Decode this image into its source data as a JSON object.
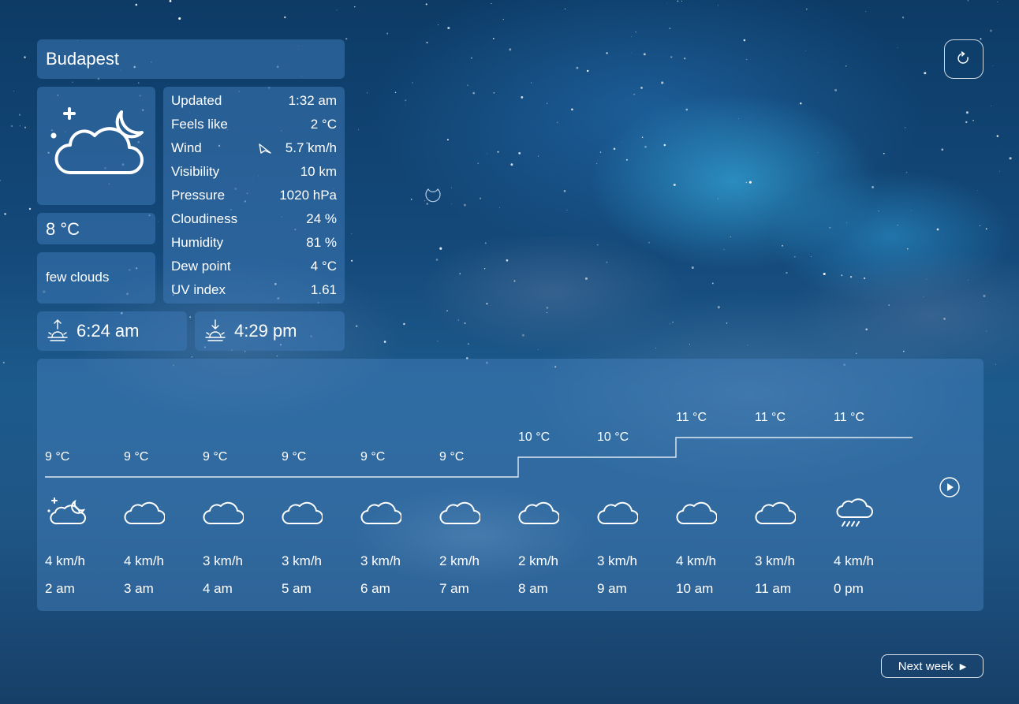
{
  "location": {
    "city": "Budapest"
  },
  "current": {
    "icon": "night-few-clouds-icon",
    "temperature": "8 °C",
    "description": "few clouds"
  },
  "details": [
    {
      "label": "Updated",
      "value": "1:32 am"
    },
    {
      "label": "Feels like",
      "value": "2 °C"
    },
    {
      "label": "Wind",
      "value": "5.7 km/h",
      "icon": "wind-direction-icon"
    },
    {
      "label": "Visibility",
      "value": "10 km"
    },
    {
      "label": "Pressure",
      "value": "1020 hPa"
    },
    {
      "label": "Cloudiness",
      "value": "24 %"
    },
    {
      "label": "Humidity",
      "value": "81 %"
    },
    {
      "label": "Dew point",
      "value": "4 °C"
    },
    {
      "label": "UV index",
      "value": "1.61"
    }
  ],
  "sun": {
    "sunrise": "6:24 am",
    "sunset": "4:29 pm"
  },
  "hourly": [
    {
      "time": "2 am",
      "temp_label": "9 °C",
      "temp": 9,
      "wind": "4 km/h",
      "icon": "night-few-clouds-icon"
    },
    {
      "time": "3 am",
      "temp_label": "9 °C",
      "temp": 9,
      "wind": "4 km/h",
      "icon": "cloud-icon"
    },
    {
      "time": "4 am",
      "temp_label": "9 °C",
      "temp": 9,
      "wind": "3 km/h",
      "icon": "cloud-icon"
    },
    {
      "time": "5 am",
      "temp_label": "9 °C",
      "temp": 9,
      "wind": "3 km/h",
      "icon": "cloud-icon"
    },
    {
      "time": "6 am",
      "temp_label": "9 °C",
      "temp": 9,
      "wind": "3 km/h",
      "icon": "cloud-icon"
    },
    {
      "time": "7 am",
      "temp_label": "9 °C",
      "temp": 9,
      "wind": "2 km/h",
      "icon": "cloud-icon"
    },
    {
      "time": "8 am",
      "temp_label": "10 °C",
      "temp": 10,
      "wind": "2 km/h",
      "icon": "cloud-icon"
    },
    {
      "time": "9 am",
      "temp_label": "10 °C",
      "temp": 10,
      "wind": "3 km/h",
      "icon": "cloud-icon"
    },
    {
      "time": "10 am",
      "temp_label": "11 °C",
      "temp": 11,
      "wind": "4 km/h",
      "icon": "cloud-icon"
    },
    {
      "time": "11 am",
      "temp_label": "11 °C",
      "temp": 11,
      "wind": "3 km/h",
      "icon": "cloud-icon"
    },
    {
      "time": "0 pm",
      "temp_label": "11 °C",
      "temp": 11,
      "wind": "4 km/h",
      "icon": "cloud-rain-icon"
    }
  ],
  "controls": {
    "refresh_icon": "refresh-icon",
    "play_icon": "play-icon",
    "next_week_label": "Next week"
  }
}
